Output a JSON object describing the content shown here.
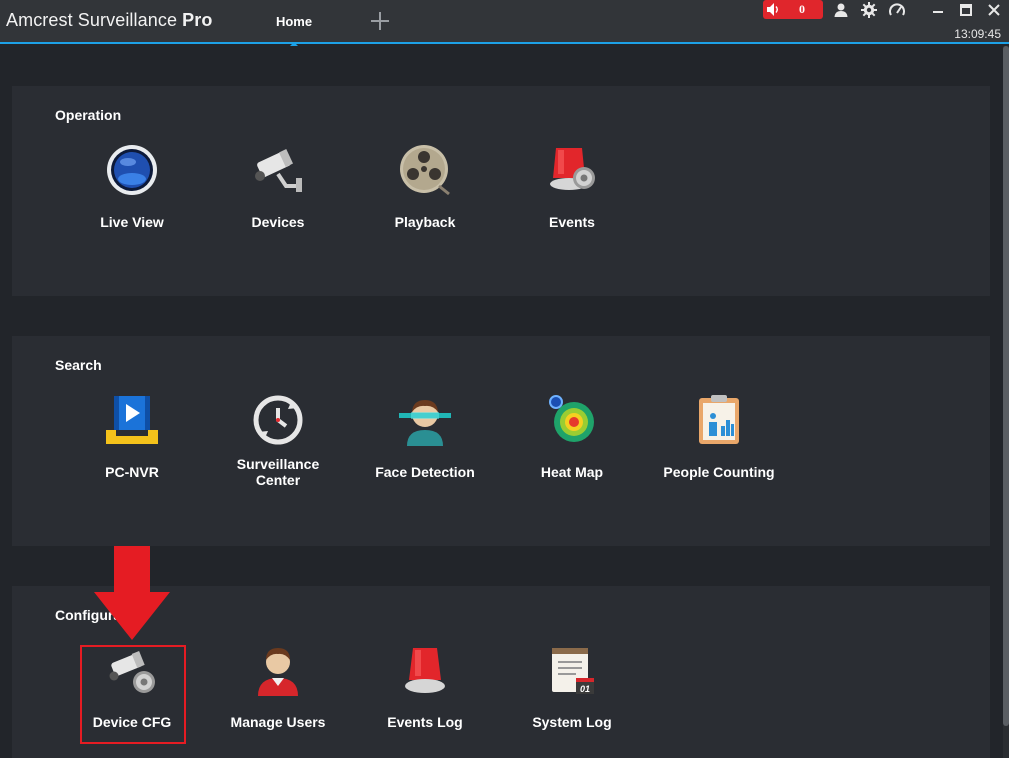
{
  "app": {
    "title_main": "Amcrest Surveillance ",
    "title_bold": "Pro"
  },
  "tabs": [
    {
      "label": "Home",
      "active": true
    }
  ],
  "topbar": {
    "alarm_count": "0",
    "icons": [
      "speaker-icon",
      "user-icon",
      "gear-icon",
      "gauge-icon"
    ],
    "window_controls": [
      "minimize",
      "maximize",
      "close"
    ],
    "clock": "13:09:45"
  },
  "sections": [
    {
      "title": "Operation",
      "items": [
        {
          "label": "Live View",
          "icon": "live-view-icon"
        },
        {
          "label": "Devices",
          "icon": "camera-icon"
        },
        {
          "label": "Playback",
          "icon": "film-reel-icon"
        },
        {
          "label": "Events",
          "icon": "alarm-gear-icon"
        }
      ]
    },
    {
      "title": "Search",
      "items": [
        {
          "label": "PC-NVR",
          "icon": "pc-nvr-icon"
        },
        {
          "label": "Surveillance\nCenter",
          "icon": "sync-clock-icon"
        },
        {
          "label": "Face Detection",
          "icon": "face-scan-icon"
        },
        {
          "label": "Heat Map",
          "icon": "heat-map-icon"
        },
        {
          "label": "People Counting",
          "icon": "clipboard-chart-icon"
        }
      ]
    },
    {
      "title": "Configuration",
      "items": [
        {
          "label": "Device CFG",
          "icon": "camera-gear-icon"
        },
        {
          "label": "Manage Users",
          "icon": "user-avatar-icon"
        },
        {
          "label": "Events Log",
          "icon": "alarm-light-icon"
        },
        {
          "label": "System Log",
          "icon": "notepad-log-icon"
        }
      ]
    }
  ],
  "colors": {
    "accent": "#1da1e6",
    "alarm": "#e0262c",
    "highlight": "#e51c23",
    "background": "#22252a",
    "panel": "#2a2d33"
  }
}
